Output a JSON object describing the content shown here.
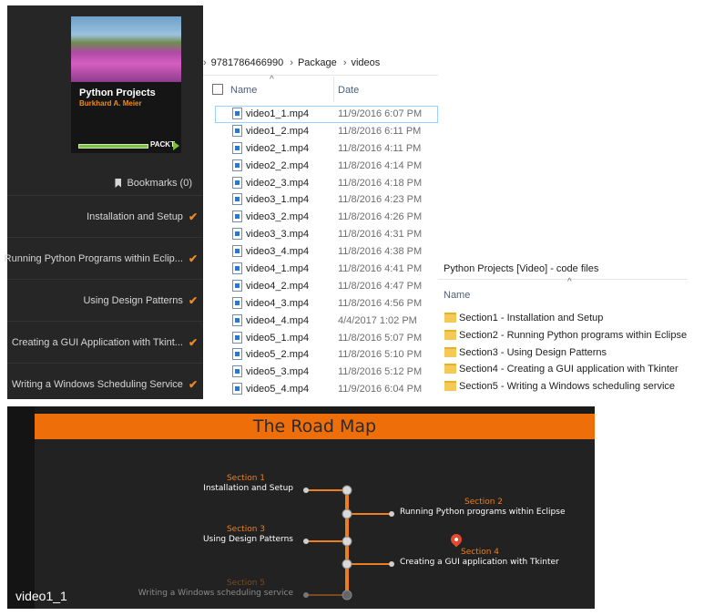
{
  "course": {
    "cover": {
      "title": "Python Projects",
      "author": "Burkhard A. Meier",
      "publisher": "PACKT"
    },
    "bookmarks_label": "Bookmarks (0)",
    "sections": [
      {
        "label": "Installation and Setup",
        "completed": true
      },
      {
        "label": "Running Python Programs within Eclip...",
        "completed": true
      },
      {
        "label": "Using Design Patterns",
        "completed": true
      },
      {
        "label": "Creating a GUI Application with Tkint...",
        "completed": true
      },
      {
        "label": "Writing a Windows Scheduling Service",
        "completed": true
      }
    ],
    "check_glyph": "✔",
    "colors": {
      "background": "#262626",
      "accent": "#f08a1c"
    }
  },
  "explorer": {
    "breadcrumb": [
      "9781786466990",
      "Package",
      "videos"
    ],
    "breadcrumb_separator": "›",
    "columns": {
      "name": "Name",
      "date": "Date"
    },
    "sort_glyph": "^",
    "files": [
      {
        "name": "video1_1.mp4",
        "date": "11/9/2016 6:07 PM",
        "selected": true
      },
      {
        "name": "video1_2.mp4",
        "date": "11/8/2016 6:11 PM"
      },
      {
        "name": "video2_1.mp4",
        "date": "11/8/2016 4:11 PM"
      },
      {
        "name": "video2_2.mp4",
        "date": "11/8/2016 4:14 PM"
      },
      {
        "name": "video2_3.mp4",
        "date": "11/8/2016 4:18 PM"
      },
      {
        "name": "video3_1.mp4",
        "date": "11/8/2016 4:23 PM"
      },
      {
        "name": "video3_2.mp4",
        "date": "11/8/2016 4:26 PM"
      },
      {
        "name": "video3_3.mp4",
        "date": "11/8/2016 4:31 PM"
      },
      {
        "name": "video3_4.mp4",
        "date": "11/8/2016 4:38 PM"
      },
      {
        "name": "video4_1.mp4",
        "date": "11/8/2016 4:41 PM"
      },
      {
        "name": "video4_2.mp4",
        "date": "11/8/2016 4:47 PM"
      },
      {
        "name": "video4_3.mp4",
        "date": "11/8/2016 4:56 PM"
      },
      {
        "name": "video4_4.mp4",
        "date": "4/4/2017 1:02 PM"
      },
      {
        "name": "video5_1.mp4",
        "date": "11/8/2016 5:07 PM"
      },
      {
        "name": "video5_2.mp4",
        "date": "11/8/2016 5:10 PM"
      },
      {
        "name": "video5_3.mp4",
        "date": "11/8/2016 5:12 PM"
      },
      {
        "name": "video5_4.mp4",
        "date": "11/9/2016 6:04 PM"
      }
    ]
  },
  "code_files": {
    "title": "Python Projects  [Video] - code files",
    "column_name": "Name",
    "sort_glyph": "^",
    "folders": [
      "Section1 - Installation and Setup",
      "Section2 - Running Python programs within Eclipse",
      "Section3 - Using Design Patterns",
      "Section4 - Creating a GUI application with Tkinter",
      "Section5 - Writing a Windows scheduling service"
    ]
  },
  "video": {
    "slide_title": "The Road Map",
    "label": "video1_1",
    "sections": [
      {
        "number": "Section 1",
        "title": "Installation and Setup",
        "side": "left"
      },
      {
        "number": "Section 2",
        "title": "Running Python programs within Eclipse",
        "side": "right"
      },
      {
        "number": "Section 3",
        "title": "Using Design Patterns",
        "side": "left"
      },
      {
        "number": "Section 4",
        "title": "Creating a GUI application with Tkinter",
        "side": "right",
        "current": true
      },
      {
        "number": "Section 5",
        "title": "Writing a Windows scheduling service",
        "side": "left",
        "dim": true
      }
    ],
    "colors": {
      "banner": "#ee6f0a",
      "timeline": "#ee7d1d",
      "background": "#222222"
    }
  }
}
